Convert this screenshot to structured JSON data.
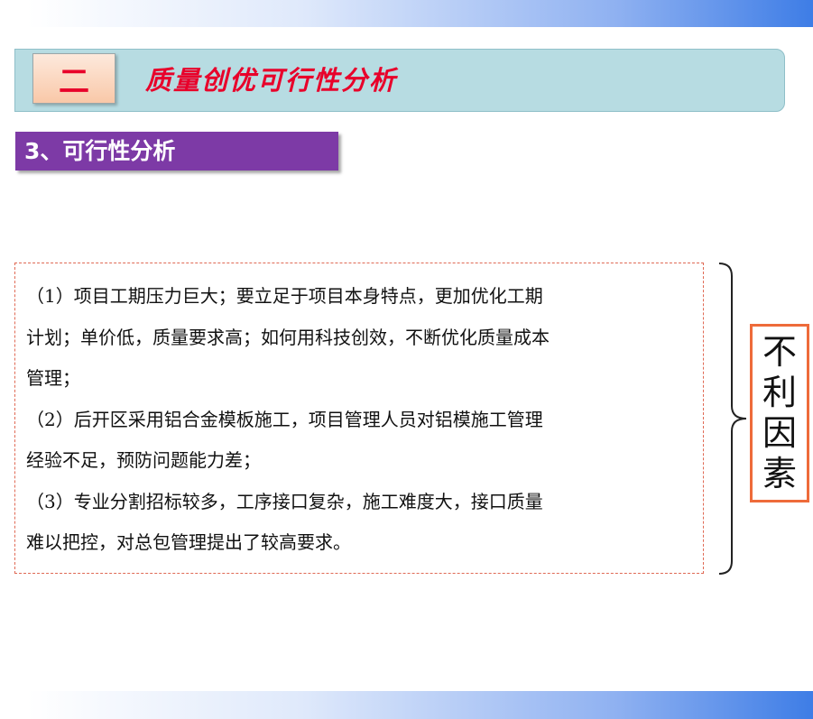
{
  "section": {
    "number": "二",
    "title": "质量创优可行性分析"
  },
  "subsection": {
    "title": "3、可行性分析"
  },
  "content": {
    "lines": [
      "（1）项目工期压力巨大；要立足于项目本身特点，更加优化工期",
      "计划；单价低，质量要求高；如何用科技创效，不断优化质量成本",
      "管理；",
      "（2）后开区采用铝合金模板施工，项目管理人员对铝模施工管理",
      "经验不足，预防问题能力差；",
      "（3）专业分割招标较多，工序接口复杂，施工难度大，接口质量",
      "难以把控，对总包管理提出了较高要求。"
    ]
  },
  "side_label": {
    "chars": [
      "不",
      "利",
      "因",
      "素"
    ]
  },
  "colors": {
    "accent_red": "#e8002a",
    "banner_teal": "#b7dce2",
    "sub_banner_purple": "#7d3aa6",
    "label_border_orange": "#ee6b3a"
  }
}
